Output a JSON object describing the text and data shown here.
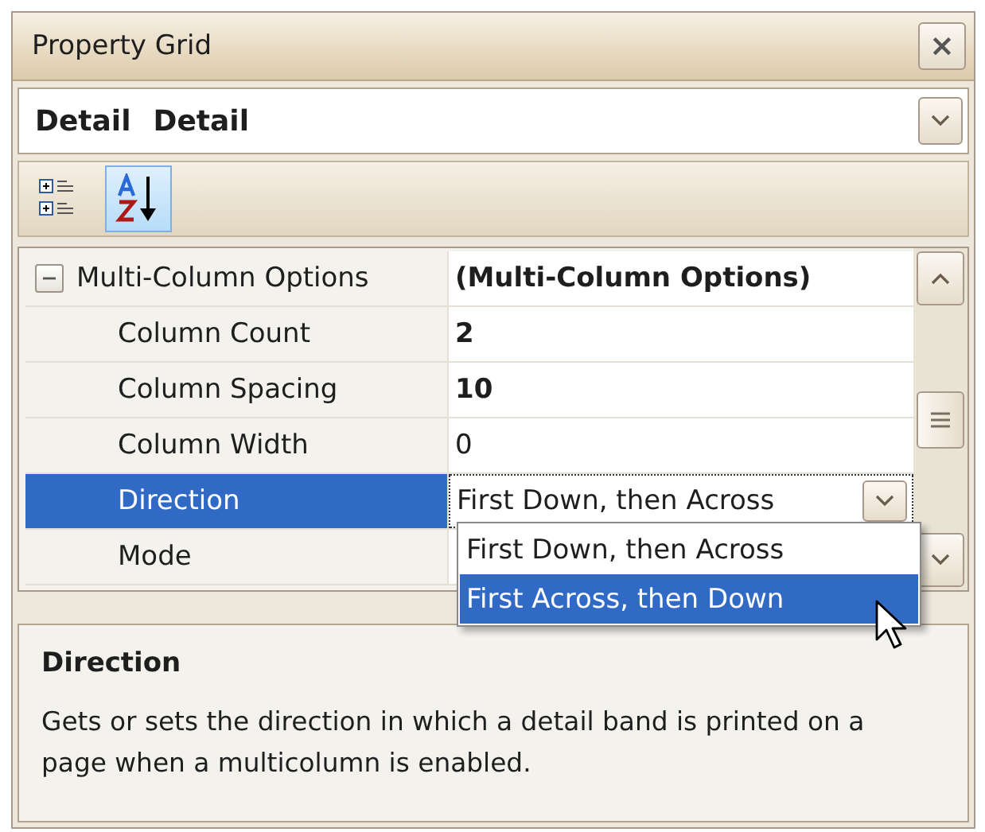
{
  "window": {
    "title": "Property Grid",
    "close_label": "×"
  },
  "object_selector": {
    "name": "Detail",
    "type": "Detail"
  },
  "toolbar": [
    {
      "kind": "categorized",
      "selected": false
    },
    {
      "kind": "alphabetical",
      "selected": true
    }
  ],
  "grid": {
    "rows": [
      {
        "kind": "category",
        "name": "Multi-Column Options",
        "value": "(Multi-Column Options)",
        "expanded": true,
        "selected": false,
        "modified": true,
        "children": [
          {
            "kind": "property",
            "name": "Column Count",
            "value": "2",
            "modified": true,
            "selected": false
          },
          {
            "kind": "property",
            "name": "Column Spacing",
            "value": "10",
            "modified": true,
            "selected": false
          },
          {
            "kind": "property",
            "name": "Column Width",
            "value": "0",
            "modified": false,
            "selected": false
          },
          {
            "kind": "dropdown",
            "name": "Direction",
            "value": "First Down, then Across",
            "modified": false,
            "selected": true
          },
          {
            "kind": "property",
            "name": "Mode",
            "modified": false,
            "selected": false
          }
        ]
      }
    ]
  },
  "dropdown": {
    "options": [
      {
        "label": "First Down, then Across",
        "selected": false
      },
      {
        "label": "First Across, then Down",
        "selected": true
      }
    ]
  },
  "description": {
    "title": "Direction",
    "text": "Gets or sets the direction in which a detail band is printed on a page when a multicolumn is enabled."
  }
}
